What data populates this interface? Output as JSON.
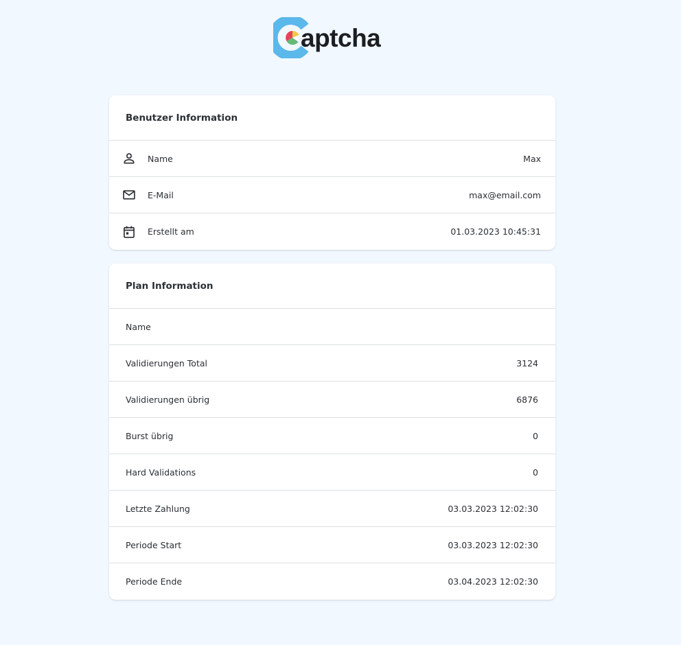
{
  "brand": {
    "logo_text": "aptcha",
    "logo_letter": "C",
    "colors": {
      "blue": "#5bb8ea",
      "red": "#e0465a",
      "yellow": "#f3c74a",
      "green": "#66ba78"
    }
  },
  "user_info": {
    "title": "Benutzer Information",
    "rows": [
      {
        "icon": "person-icon",
        "label": "Name",
        "value": "Max"
      },
      {
        "icon": "mail-icon",
        "label": "E-Mail",
        "value": "max@email.com"
      },
      {
        "icon": "calendar-icon",
        "label": "Erstellt am",
        "value": "01.03.2023 10:45:31"
      }
    ]
  },
  "plan_info": {
    "title": "Plan Information",
    "rows": [
      {
        "label": "Name",
        "value": ""
      },
      {
        "label": "Validierungen Total",
        "value": "3124"
      },
      {
        "label": "Validierungen übrig",
        "value": "6876"
      },
      {
        "label": "Burst übrig",
        "value": "0"
      },
      {
        "label": "Hard Validations",
        "value": "0"
      },
      {
        "label": "Letzte Zahlung",
        "value": "03.03.2023 12:02:30"
      },
      {
        "label": "Periode Start",
        "value": "03.03.2023 12:02:30"
      },
      {
        "label": "Periode Ende",
        "value": "03.04.2023 12:02:30"
      }
    ]
  }
}
